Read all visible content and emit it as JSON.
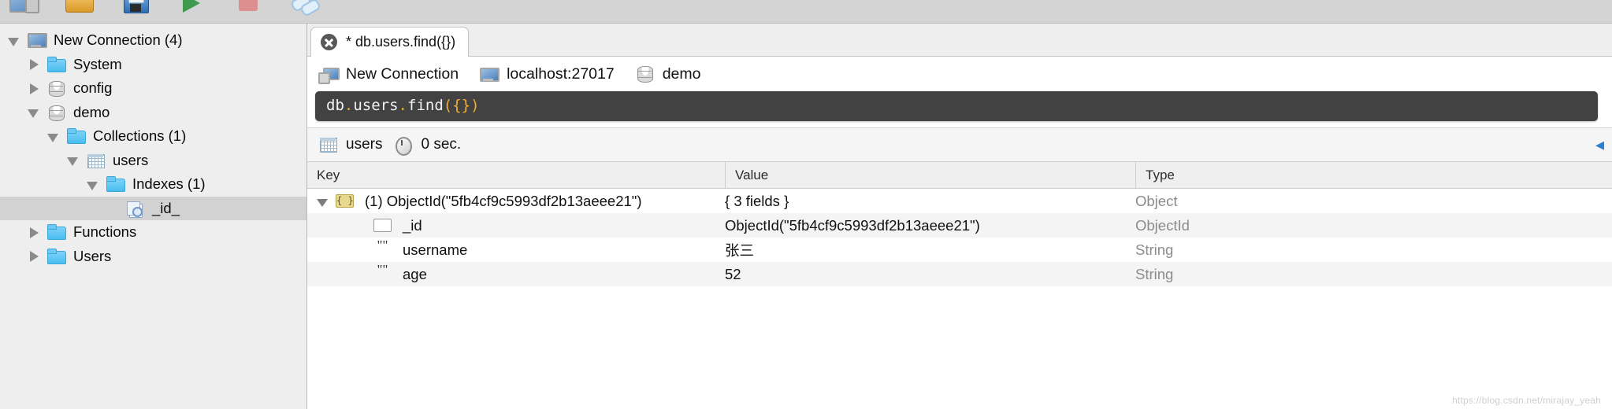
{
  "toolbar": {
    "buttons": [
      {
        "name": "connect",
        "icon": "connection-icon"
      },
      {
        "name": "open",
        "icon": "open-folder-icon"
      },
      {
        "name": "save",
        "icon": "save-floppy-icon"
      },
      {
        "name": "execute",
        "icon": "play-icon"
      },
      {
        "name": "stop",
        "icon": "stop-icon"
      },
      {
        "name": "link",
        "icon": "link-icon"
      }
    ]
  },
  "tree": {
    "items": [
      {
        "label": "New Connection (4)",
        "icon": "monitor-icon",
        "indent": 0,
        "arrow": "open",
        "selected": false
      },
      {
        "label": "System",
        "icon": "folder-icon",
        "indent": 1,
        "arrow": "closed",
        "selected": false
      },
      {
        "label": "config",
        "icon": "database-icon",
        "indent": 1,
        "arrow": "closed",
        "selected": false
      },
      {
        "label": "demo",
        "icon": "database-icon",
        "indent": 1,
        "arrow": "open",
        "selected": false
      },
      {
        "label": "Collections (1)",
        "icon": "folder-icon",
        "indent": 2,
        "arrow": "open",
        "selected": false
      },
      {
        "label": "users",
        "icon": "grid-icon",
        "indent": 3,
        "arrow": "open",
        "selected": false
      },
      {
        "label": "Indexes (1)",
        "icon": "folder-icon",
        "indent": 4,
        "arrow": "open",
        "selected": false
      },
      {
        "label": "_id_",
        "icon": "index-icon",
        "indent": 5,
        "arrow": "none",
        "selected": true
      },
      {
        "label": "Functions",
        "icon": "folder-icon",
        "indent": 1,
        "arrow": "closed",
        "selected": false
      },
      {
        "label": "Users",
        "icon": "folder-icon",
        "indent": 1,
        "arrow": "closed",
        "selected": false
      }
    ]
  },
  "tabs": [
    {
      "label": "* db.users.find({})",
      "close_icon": "close-icon",
      "active": true
    }
  ],
  "connection_bar": {
    "items": [
      {
        "label": "New Connection",
        "icon": "server-icon"
      },
      {
        "label": "localhost:27017",
        "icon": "monitor-icon"
      },
      {
        "label": "demo",
        "icon": "database-icon"
      }
    ]
  },
  "editor": {
    "prefix": "db.users.find",
    "punctuation_open": "({})",
    "full_text": "db.users.find({})",
    "segments": [
      {
        "text": "db",
        "kind": "plain"
      },
      {
        "text": ".",
        "kind": "punct"
      },
      {
        "text": "users",
        "kind": "plain"
      },
      {
        "text": ".",
        "kind": "punct"
      },
      {
        "text": "find",
        "kind": "plain"
      },
      {
        "text": "({})",
        "kind": "punct"
      }
    ]
  },
  "result_bar": {
    "collection": "users",
    "collection_icon": "grid-icon",
    "time_icon": "clock-icon",
    "time": "0 sec.",
    "expand_icon": "chevron-left-icon"
  },
  "table": {
    "columns": [
      "Key",
      "Value",
      "Type"
    ],
    "rows": [
      {
        "key": "(1) ObjectId(\"5fb4cf9c5993df2b13aeee21\")",
        "value": "{ 3 fields }",
        "type": "Object",
        "icon": "object-braces-icon",
        "arrow": "open",
        "indent": 0
      },
      {
        "key": "_id",
        "value": "ObjectId(\"5fb4cf9c5993df2b13aeee21\")",
        "type": "ObjectId",
        "icon": "blank-field-icon",
        "arrow": "none",
        "indent": 1
      },
      {
        "key": "username",
        "value": "张三",
        "type": "String",
        "icon": "string-quotes-icon",
        "arrow": "none",
        "indent": 1
      },
      {
        "key": "age",
        "value": "52",
        "type": "String",
        "icon": "string-quotes-icon",
        "arrow": "none",
        "indent": 1
      }
    ]
  },
  "footer": {
    "watermark": "https://blog.csdn.net/mirajay_yeah"
  },
  "colors": {
    "selection": "#d2d2d2",
    "editor_bg": "#424242",
    "editor_punct": "#f0ad2e",
    "tree_bg": "#eeeeee",
    "type_text": "#8c8c8c"
  }
}
